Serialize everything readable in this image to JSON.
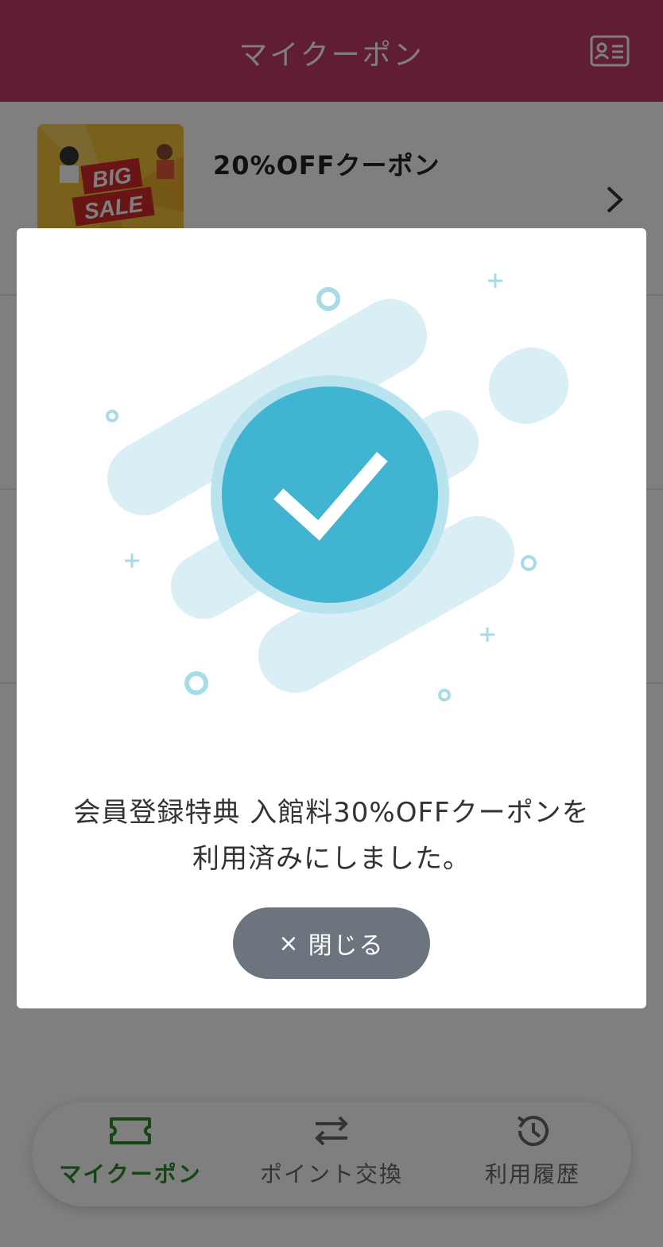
{
  "header": {
    "title": "マイクーポン",
    "member_card_icon": "id-card-icon"
  },
  "coupons": [
    {
      "title": "20%OFFクーポン",
      "image_text": "BIG SALE",
      "image_icon": "big-sale-banner-image"
    }
  ],
  "modal": {
    "message_line1": "会員登録特典 入館料30%OFFクーポンを",
    "message_line2": "利用済みにしました。",
    "close_icon": "×",
    "close_label": "閉じる",
    "illustration_icon": "check-circle-icon"
  },
  "nav": {
    "items": [
      {
        "label": "マイクーポン",
        "icon": "ticket-icon",
        "active": true
      },
      {
        "label": "ポイント交換",
        "icon": "exchange-arrows-icon",
        "active": false
      },
      {
        "label": "利用履歴",
        "icon": "history-icon",
        "active": false
      }
    ]
  },
  "colors": {
    "header": "#c03a66",
    "nav_active": "#2d8a2d",
    "nav_inactive": "#666666",
    "check_circle": "#40b4d0",
    "close_button": "#6c757d"
  }
}
